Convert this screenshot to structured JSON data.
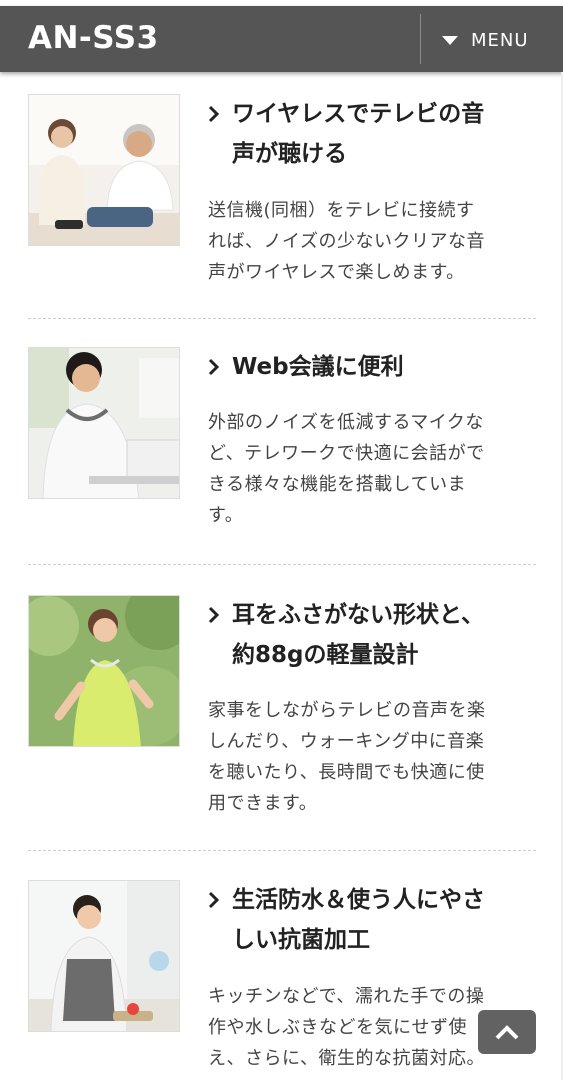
{
  "header": {
    "brand": "AN-SS3",
    "menu_label": "MENU"
  },
  "features": [
    {
      "title_line1": "ワイヤレスでテレビの音",
      "title_line2": "声が聴ける",
      "desc_lines": [
        "送信機(同梱）をテレビに接続す",
        "れば、ノイズの少ないクリアな音",
        "声がワイヤレスで楽しめます。"
      ],
      "image": "senior-couple-photo"
    },
    {
      "title_line1": "Web会議に便利",
      "title_line2": "",
      "desc_lines": [
        "外部のノイズを低減するマイクな",
        "ど、テレワークで快適に会話がで",
        "きる様々な機能を搭載していま",
        "す。"
      ],
      "image": "man-at-laptop-photo"
    },
    {
      "title_line1": "耳をふさがない形状と、",
      "title_line2": "約88gの軽量設計",
      "desc_lines": [
        "家事をしながらテレビの音声を楽",
        "しんだり、ウォーキング中に音楽",
        "を聴いたり、長時間でも快適に使",
        "用できます。"
      ],
      "image": "woman-jogging-photo"
    },
    {
      "title_line1": "生活防水＆使う人にやさ",
      "title_line2": "しい抗菌加工",
      "desc_lines": [
        "キッチンなどで、濡れた手での操",
        "作や水しぶきなどを気にせず使",
        "え、さらに、衛生的な抗菌対応。"
      ],
      "image": "woman-cooking-photo"
    }
  ],
  "colors": {
    "header_bg": "#555555",
    "text": "#333333"
  },
  "icons": {
    "menu": "caret-down-icon",
    "title_bullet": "chevron-right-icon",
    "back_to_top": "chevron-up-icon"
  }
}
